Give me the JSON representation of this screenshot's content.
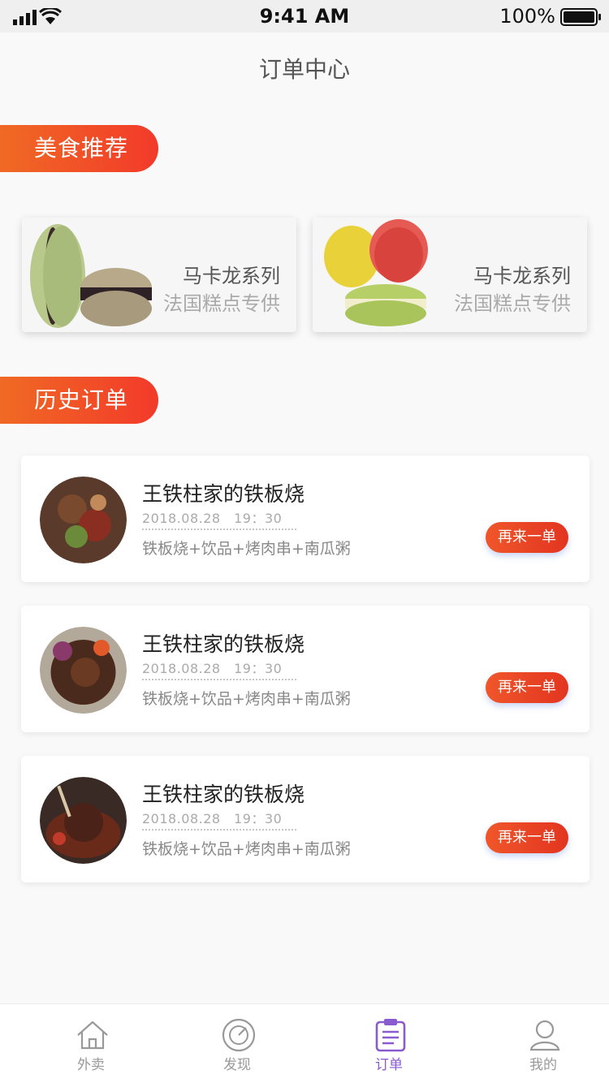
{
  "status": {
    "time": "9:41 AM",
    "battery": "100%"
  },
  "header": {
    "title": "订单中心"
  },
  "recommend": {
    "section_label": "美食推荐",
    "items": [
      {
        "title": "马卡龙系列",
        "subtitle": "法国糕点专供"
      },
      {
        "title": "马卡龙系列",
        "subtitle": "法国糕点专供"
      }
    ]
  },
  "history": {
    "section_label": "历史订单",
    "orders": [
      {
        "shop": "王铁柱家的铁板烧",
        "date": "2018.08.28　19：30",
        "items": "铁板烧+饮品+烤肉串+南瓜粥",
        "button": "再来一单"
      },
      {
        "shop": "王铁柱家的铁板烧",
        "date": "2018.08.28　19：30",
        "items": "铁板烧+饮品+烤肉串+南瓜粥",
        "button": "再来一单"
      },
      {
        "shop": "王铁柱家的铁板烧",
        "date": "2018.08.28　19：30",
        "items": "铁板烧+饮品+烤肉串+南瓜粥",
        "button": "再来一单"
      }
    ]
  },
  "tabbar": {
    "active": "订单",
    "active_color": "#8a5ad0",
    "items": [
      {
        "label": "外卖",
        "icon": "home-icon"
      },
      {
        "label": "发现",
        "icon": "compass-icon"
      },
      {
        "label": "订单",
        "icon": "clipboard-icon"
      },
      {
        "label": "我的",
        "icon": "user-icon"
      }
    ]
  },
  "colors": {
    "accent_orange": "#f06a24",
    "accent_red": "#f23a2a"
  }
}
